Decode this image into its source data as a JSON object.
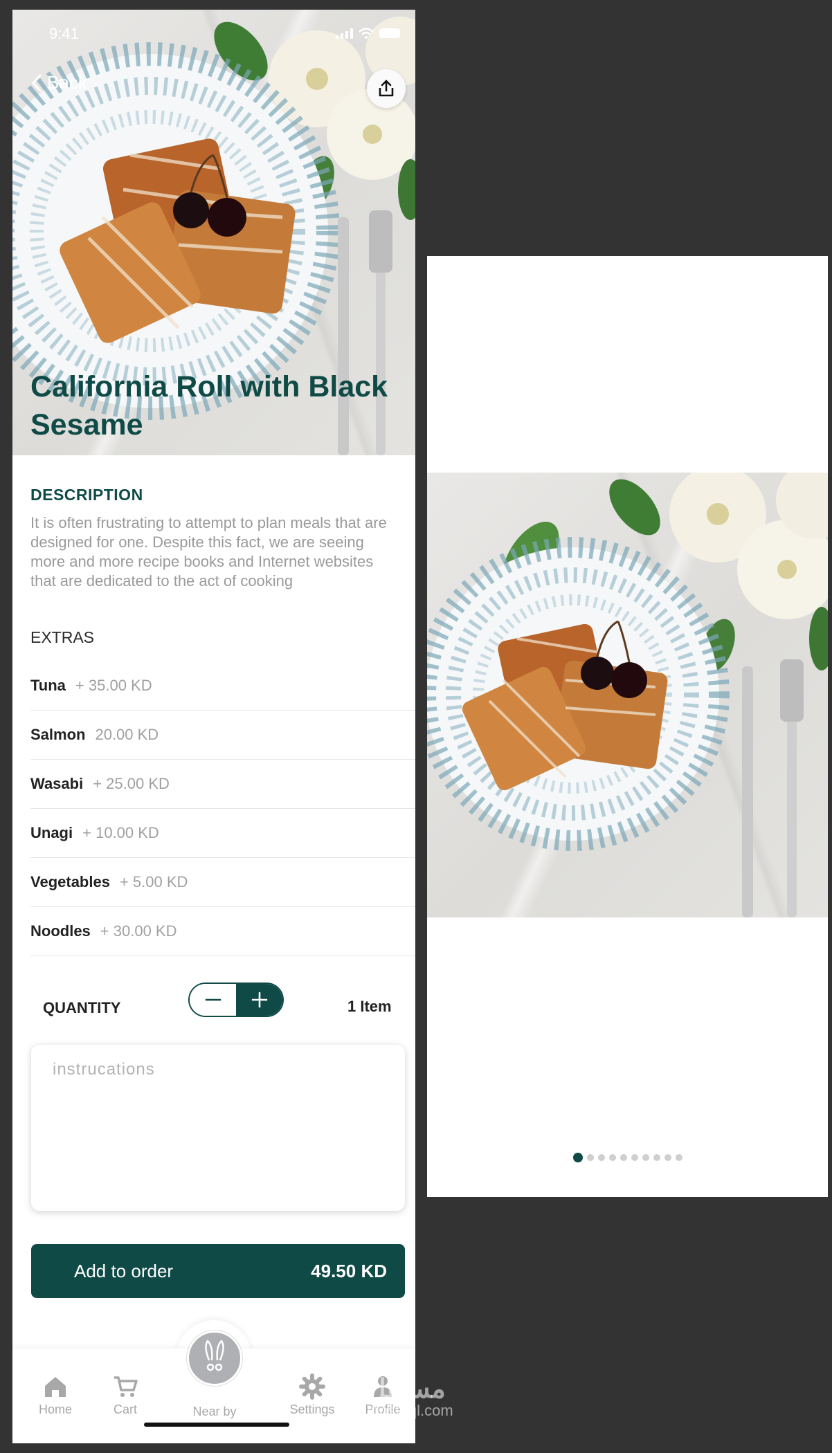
{
  "status_bar": {
    "time": "9:41"
  },
  "nav": {
    "back_label": "Back"
  },
  "dish": {
    "title": "California Roll with Black Sesame",
    "description_label": "DESCRIPTION",
    "description": "It is often frustrating to attempt to plan meals that are designed for one. Despite this fact, we are seeing more and more recipe books and Internet websites that are dedicated to the act of cooking"
  },
  "extras": {
    "label": "EXTRAS",
    "items": [
      {
        "name": "Tuna",
        "price": "+ 35.00 KD"
      },
      {
        "name": "Salmon",
        "price": "20.00  KD"
      },
      {
        "name": "Wasabi",
        "price": "+ 25.00  KD"
      },
      {
        "name": "Unagi",
        "price": "+ 10.00  KD"
      },
      {
        "name": "Vegetables",
        "price": "+ 5.00  KD"
      },
      {
        "name": "Noodles",
        "price": "+ 30.00  KD"
      }
    ]
  },
  "quantity": {
    "label": "QUANTITY",
    "count_text": "1 Item"
  },
  "instructions": {
    "placeholder": "instrucations"
  },
  "order": {
    "button_label": "Add to order",
    "total": "49.50  KD"
  },
  "tabbar": {
    "home": "Home",
    "cart": "Cart",
    "nearby": "Near by",
    "settings": "Settings",
    "profile": "Profile"
  },
  "gallery": {
    "dot_count": 10,
    "active_index": 0
  },
  "watermark": {
    "arabic": "مستقل",
    "latin": "mostaql.com"
  },
  "colors": {
    "primary": "#0f4a46",
    "muted": "#a0a0a0",
    "background": "#333333"
  }
}
